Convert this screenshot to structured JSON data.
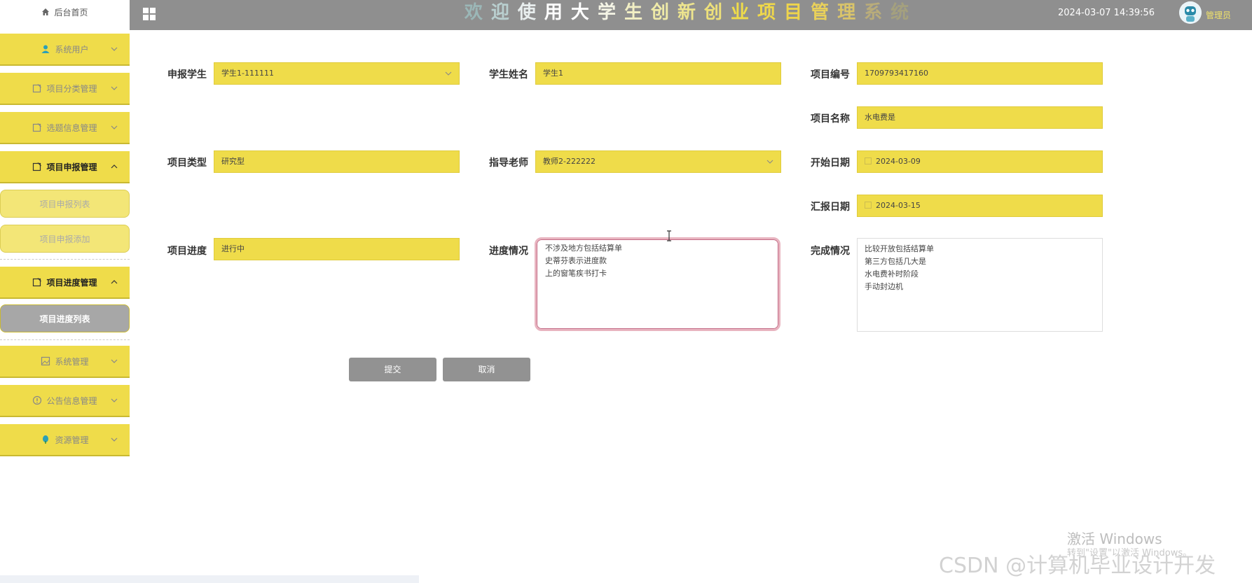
{
  "sidebar": {
    "home_label": "后台首页",
    "items": [
      {
        "label": "系统用户",
        "icon": "user-icon"
      },
      {
        "label": "项目分类管理",
        "icon": "edit-icon"
      },
      {
        "label": "选题信息管理",
        "icon": "edit-icon"
      },
      {
        "label": "项目申报管理",
        "icon": "edit-icon"
      },
      {
        "label": "项目进度管理",
        "icon": "edit-icon"
      },
      {
        "label": "系统管理",
        "icon": "image-icon"
      },
      {
        "label": "公告信息管理",
        "icon": "alert-icon"
      },
      {
        "label": "资源管理",
        "icon": "leaf-icon"
      }
    ],
    "sub_items": [
      {
        "label": "项目申报列表"
      },
      {
        "label": "项目申报添加"
      },
      {
        "label": "项目进度列表"
      }
    ]
  },
  "header": {
    "title_chars": [
      "欢",
      "迎",
      "使",
      "用",
      "大",
      "学",
      "生",
      "创",
      "新",
      "创",
      "业",
      "项",
      "目",
      "管",
      "理",
      "系",
      "统"
    ],
    "datetime": "2024-03-07 14:39:56",
    "user": "管理员",
    "colors": {
      "bar": "#8f8f8f",
      "accent": "#efdc4a"
    }
  },
  "form": {
    "student": {
      "label": "申报学生",
      "value": "学生1-111111"
    },
    "student_name": {
      "label": "学生姓名",
      "value": "学生1"
    },
    "project_no": {
      "label": "项目编号",
      "value": "1709793417160"
    },
    "project_name": {
      "label": "项目名称",
      "value": "水电费是"
    },
    "project_type": {
      "label": "项目类型",
      "value": "研究型"
    },
    "teacher": {
      "label": "指导老师",
      "value": "教师2-222222"
    },
    "start_date": {
      "label": "开始日期",
      "value": "2024-03-09"
    },
    "report_date": {
      "label": "汇报日期",
      "value": "2024-03-15"
    },
    "progress": {
      "label": "项目进度",
      "value": "进行中"
    },
    "progress_detail": {
      "label": "进度情况",
      "value": "不涉及地方包括结算单\n史蒂芬表示进度款\n上的窗笔疾书打卡"
    },
    "completion": {
      "label": "完成情况",
      "value": "比较开放包括结算单\n第三方包括几大是\n水电费补时阶段\n手动封边机"
    }
  },
  "buttons": {
    "submit": "提交",
    "cancel": "取消"
  },
  "watermarks": {
    "activate_title": "激活 Windows",
    "activate_sub": "转到\"设置\"以激活 Windows。",
    "csdn": "CSDN @计算机毕业设计开发"
  }
}
